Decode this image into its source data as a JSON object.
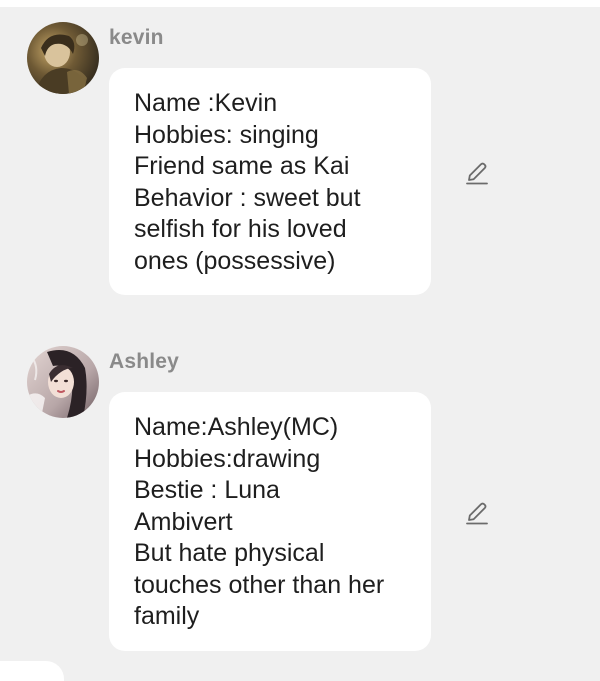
{
  "messages": [
    {
      "sender": "kevin",
      "avatar_icon": "avatar-kevin",
      "lines": [
        "Name :Kevin",
        "Hobbies: singing",
        "Friend same as Kai",
        "Behavior : sweet but",
        "selfish for his loved",
        "ones (possessive)"
      ],
      "edit_icon": "pencil-icon"
    },
    {
      "sender": "Ashley",
      "avatar_icon": "avatar-ashley",
      "lines": [
        "Name:Ashley(MC)",
        "Hobbies:drawing",
        "Bestie : Luna",
        "Ambivert",
        "But hate physical",
        "touches other than her",
        "family"
      ],
      "edit_icon": "pencil-icon"
    }
  ],
  "colors": {
    "background": "#f0f0f0",
    "bubble": "#ffffff",
    "sender_name": "#8a8a8a",
    "text": "#1e1e1e",
    "icon": "#6b6b6b"
  }
}
